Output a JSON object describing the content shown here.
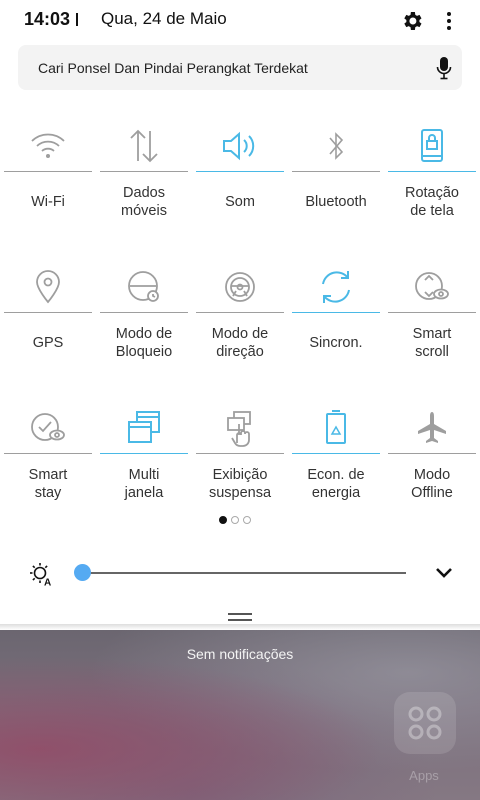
{
  "status_bar": {
    "time": "14:03",
    "date": "Qua, 24 de Maio"
  },
  "search": {
    "text": "Cari Ponsel Dan Pindai Perangkat Terdekat"
  },
  "tiles": [
    {
      "label": "Wi-Fi",
      "icon": "wifi-icon",
      "active": false
    },
    {
      "label": "Dados\nmóveis",
      "icon": "mobile-data-icon",
      "active": false
    },
    {
      "label": "Som",
      "icon": "sound-icon",
      "active": true
    },
    {
      "label": "Bluetooth",
      "icon": "bluetooth-icon",
      "active": false
    },
    {
      "label": "Rotação\nde tela",
      "icon": "screen-rotation-icon",
      "active": true
    },
    {
      "label": "GPS",
      "icon": "gps-icon",
      "active": false
    },
    {
      "label": "Modo de\nBloqueio",
      "icon": "blocking-mode-icon",
      "active": false
    },
    {
      "label": "Modo de\ndireção",
      "icon": "driving-mode-icon",
      "active": false
    },
    {
      "label": "Sincron.",
      "icon": "sync-icon",
      "active": true
    },
    {
      "label": "Smart\nscroll",
      "icon": "smart-scroll-icon",
      "active": false
    },
    {
      "label": "Smart\nstay",
      "icon": "smart-stay-icon",
      "active": false
    },
    {
      "label": "Multi\njanela",
      "icon": "multi-window-icon",
      "active": true
    },
    {
      "label": "Exibição\nsuspensa",
      "icon": "air-view-icon",
      "active": false
    },
    {
      "label": "Econ. de\nenergia",
      "icon": "power-saving-icon",
      "active": true
    },
    {
      "label": "Modo\nOffline",
      "icon": "airplane-mode-icon",
      "active": false
    }
  ],
  "page_indicator": {
    "pages": 3,
    "current": 1
  },
  "brightness": {
    "level": 0
  },
  "notifications": {
    "empty_text": "Sem notificações",
    "app_label": "Apps"
  },
  "colors": {
    "accent": "#4ab9e6",
    "inactive": "#9e9e9e",
    "slider_knob": "#55aaf2"
  }
}
